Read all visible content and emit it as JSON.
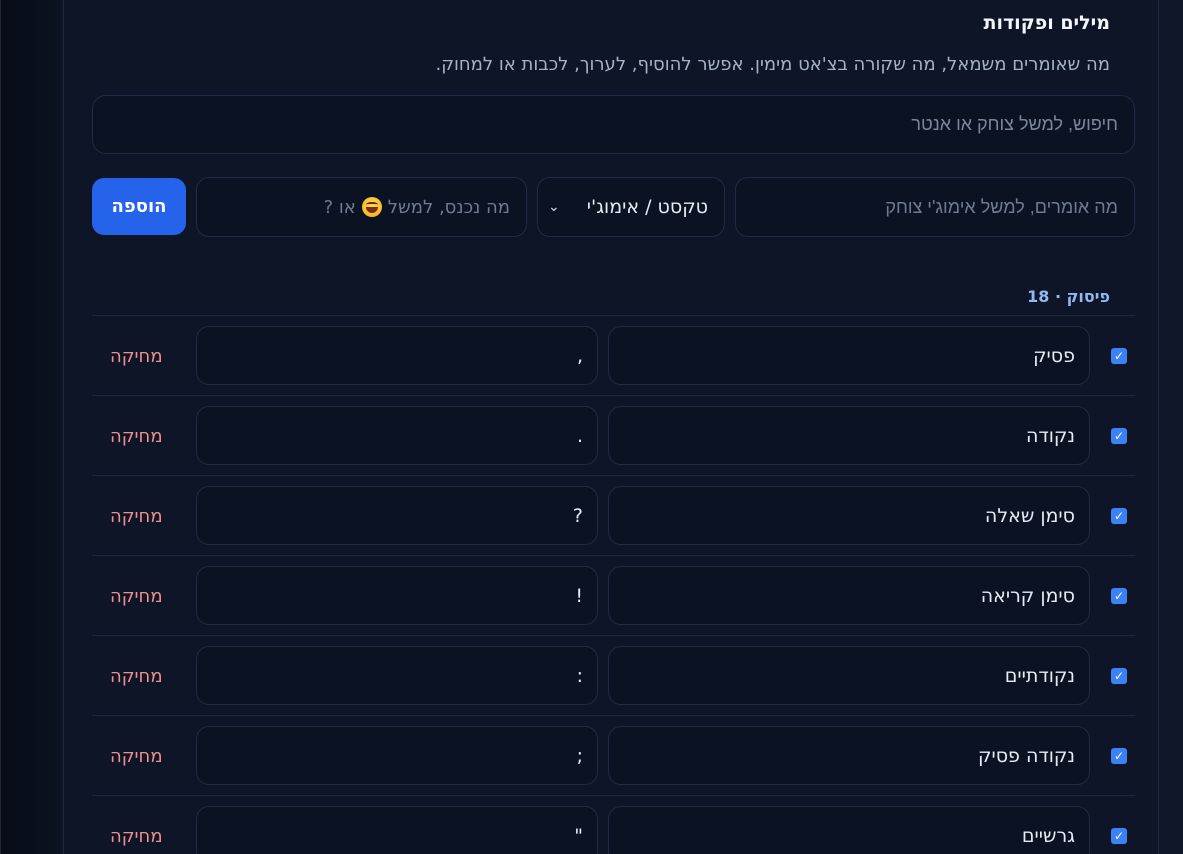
{
  "section": {
    "title": "מילים ופקודות",
    "description": "מה שאומרים משמאל, מה שקורה בצ'אט מימין. אפשר להוסיף, לערוך, לכבות או למחוק."
  },
  "search": {
    "placeholder": "חיפוש, למשל צוחק או אנטר"
  },
  "add_form": {
    "say_placeholder": "מה אומרים, למשל אימוג'י צוחק",
    "type_selected": "טקסט / אימוג'י",
    "insert_placeholder_before": "מה נכנס, למשל",
    "insert_placeholder_after": "או ?",
    "insert_emoji_icon": "laughing-emoji-icon",
    "add_label": "הוספה"
  },
  "group": {
    "label": "פיסוק · 18"
  },
  "rows": [
    {
      "name": "פסיק",
      "value": ",",
      "enabled": true,
      "delete_label": "מחיקה"
    },
    {
      "name": "נקודה",
      "value": ".",
      "enabled": true,
      "delete_label": "מחיקה"
    },
    {
      "name": "סימן שאלה",
      "value": "?",
      "enabled": true,
      "delete_label": "מחיקה"
    },
    {
      "name": "סימן קריאה",
      "value": "!",
      "enabled": true,
      "delete_label": "מחיקה"
    },
    {
      "name": "נקודתיים",
      "value": ":",
      "enabled": true,
      "delete_label": "מחיקה"
    },
    {
      "name": "נקודה פסיק",
      "value": ";",
      "enabled": true,
      "delete_label": "מחיקה"
    },
    {
      "name": "גרשיים",
      "value": "\"",
      "enabled": true,
      "delete_label": "מחיקה"
    }
  ],
  "colors": {
    "accent": "#2563eb",
    "checkbox": "#3b82f6",
    "delete": "#f08f8f",
    "group_label": "#93b7f3"
  }
}
